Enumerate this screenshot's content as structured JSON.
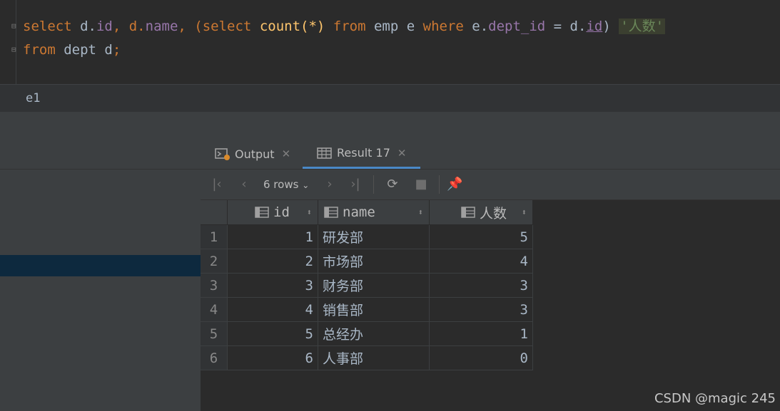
{
  "editor": {
    "line1": {
      "t1": "select",
      "t2": " d.",
      "t3": "id",
      "t4": ", d.",
      "t5": "name",
      "t6": ", (",
      "t7": "select",
      "t8": " ",
      "t9": "count",
      "t10": "(*) ",
      "t11": "from",
      "t12": " emp e ",
      "t13": "where",
      "t14": " e.",
      "t15": "dept_id",
      "t16": " = d.",
      "t17": "id",
      "t18": ") ",
      "t19": "'人数'"
    },
    "line2": {
      "t1": "from",
      "t2": " dept d",
      "t3": ";"
    }
  },
  "console": {
    "name": "e1"
  },
  "tabs": [
    {
      "label": "Output",
      "icon": "output-console-icon"
    },
    {
      "label": "Result 17",
      "icon": "table-grid-icon"
    }
  ],
  "toolbar": {
    "rows_label": "6 rows",
    "icons": [
      "first-page-icon",
      "previous-page-icon",
      "next-page-icon",
      "last-page-icon",
      "refresh-icon",
      "stop-icon",
      "pin-icon"
    ]
  },
  "table": {
    "columns": [
      "id",
      "name",
      "人数"
    ],
    "rows": [
      {
        "rn": "1",
        "id": "1",
        "name": "研发部",
        "count": "5"
      },
      {
        "rn": "2",
        "id": "2",
        "name": "市场部",
        "count": "4"
      },
      {
        "rn": "3",
        "id": "3",
        "name": "财务部",
        "count": "3"
      },
      {
        "rn": "4",
        "id": "4",
        "name": "销售部",
        "count": "3"
      },
      {
        "rn": "5",
        "id": "5",
        "name": "总经办",
        "count": "1"
      },
      {
        "rn": "6",
        "id": "6",
        "name": "人事部",
        "count": "0"
      }
    ]
  },
  "watermark": "CSDN @magic 245",
  "colors": {
    "keyword": "#cc7832",
    "field": "#9876aa",
    "function": "#ffc66d",
    "string": "#6a8759",
    "accent_tab": "#4a88c7",
    "selection": "#0d293e"
  }
}
